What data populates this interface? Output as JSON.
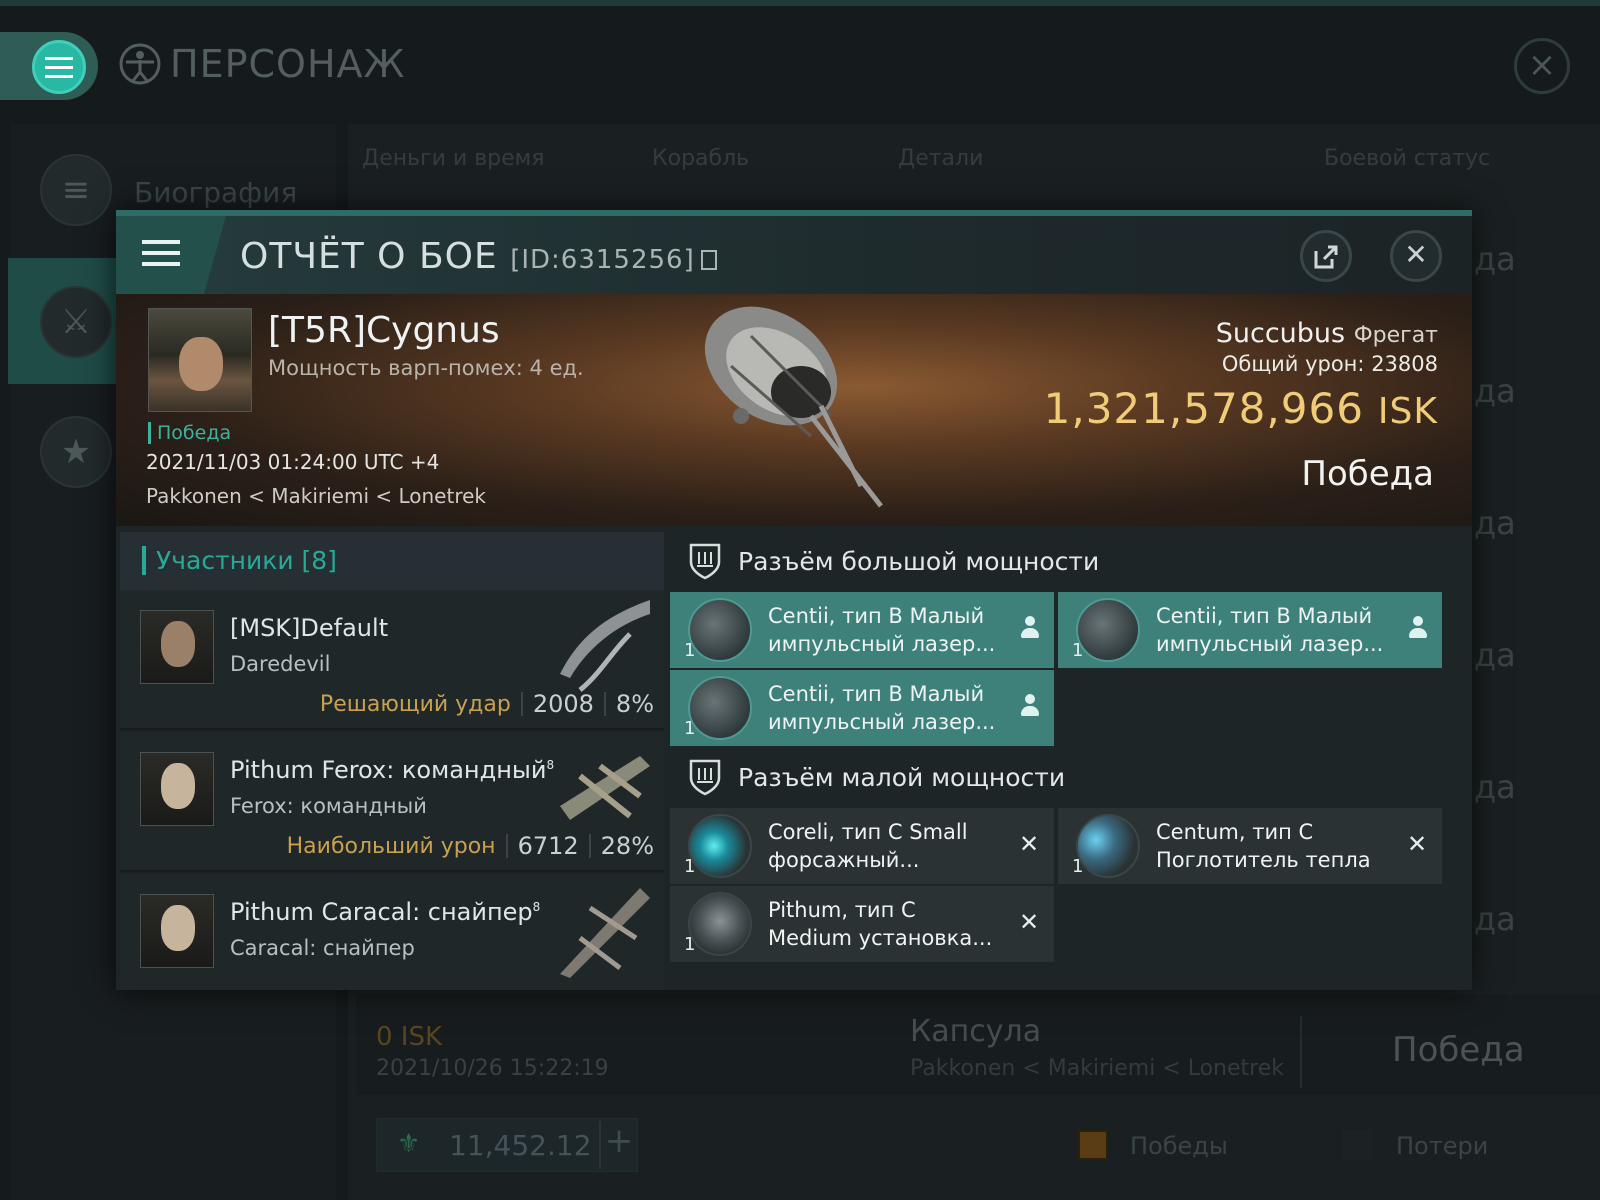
{
  "page": {
    "title": "ПЕРСОНАЖ",
    "left_tabs": [
      {
        "label": "Биография",
        "icon": "list-icon"
      },
      {
        "label": "",
        "icon": "crossed-swords-icon"
      },
      {
        "label": "",
        "icon": "star-badge-icon"
      }
    ],
    "tabs": [
      "Деньги и время",
      "Корабль",
      "Детали",
      "Боевой статус"
    ],
    "row_status": [
      "да",
      "да",
      "да",
      "да",
      "да",
      "да"
    ],
    "bottom_entry": {
      "isk": "0  ISK",
      "date": "2021/10/26  15:22:19",
      "ship": "Капсула",
      "route": "Pakkonen < Makiriemi < Lonetrek",
      "result": "Победа"
    },
    "wallet_value": "11,452.12",
    "legend": {
      "wins": "Победы",
      "losses": "Потери",
      "wins_color": "#8a5a1a",
      "losses_color": "#222a2c"
    }
  },
  "modal": {
    "title": "ОТЧЁТ О БОЕ",
    "id_label": "[ID:6315256]",
    "pilot": {
      "name": "[T5R]Cygnus",
      "warp_disrupt": "Мощность варп-помех: 4 ед.",
      "result_tag": "Победа",
      "datetime": "2021/11/03 01:24:00 UTC +4",
      "route": "Pakkonen < Makiriemi < Lonetrek"
    },
    "ship": {
      "name": "Succubus",
      "class": "Фрегат",
      "damage_label": "Общий урон:",
      "damage_value": "23808",
      "isk_value": "1,321,578,966",
      "isk_unit": "ISK",
      "result": "Победа"
    },
    "participants": {
      "title": "Участники [8]",
      "rows": [
        {
          "name": "[MSK]Default",
          "ship": "Daredevil",
          "role": "Решающий удар",
          "damage": "2008",
          "percent": "8%"
        },
        {
          "name": "Pithum Ferox: командный",
          "superscript": "8",
          "ship": "Ferox: командный",
          "role": "Наибольший урон",
          "damage": "6712",
          "percent": "28%"
        },
        {
          "name": "Pithum Caracal: снайпер",
          "superscript": "8",
          "ship": "Caracal: снайпер",
          "role": "",
          "damage": "",
          "percent": ""
        }
      ]
    },
    "high_slots": {
      "title": "Разъём большой мощности",
      "modules": [
        {
          "name_line1": "Centii, тип B Малый",
          "name_line2": "импульсный лазер...",
          "qty": "1",
          "state": "fitted"
        },
        {
          "name_line1": "Centii, тип B Малый",
          "name_line2": "импульсный лазер...",
          "qty": "1",
          "state": "fitted"
        },
        {
          "name_line1": "Centii, тип B Малый",
          "name_line2": "импульсный лазер...",
          "qty": "1",
          "state": "fitted"
        }
      ]
    },
    "mid_slots": {
      "title": "Разъём малой мощности",
      "modules": [
        {
          "name_line1": "Coreli, тип C Small",
          "name_line2": "форсажный...",
          "qty": "1",
          "state": "destroyed"
        },
        {
          "name_line1": "Centum, тип C",
          "name_line2": "Поглотитель тепла",
          "qty": "1",
          "state": "destroyed"
        },
        {
          "name_line1": "Pithum, тип C",
          "name_line2": "Medium установка...",
          "qty": "1",
          "state": "destroyed"
        }
      ]
    }
  }
}
